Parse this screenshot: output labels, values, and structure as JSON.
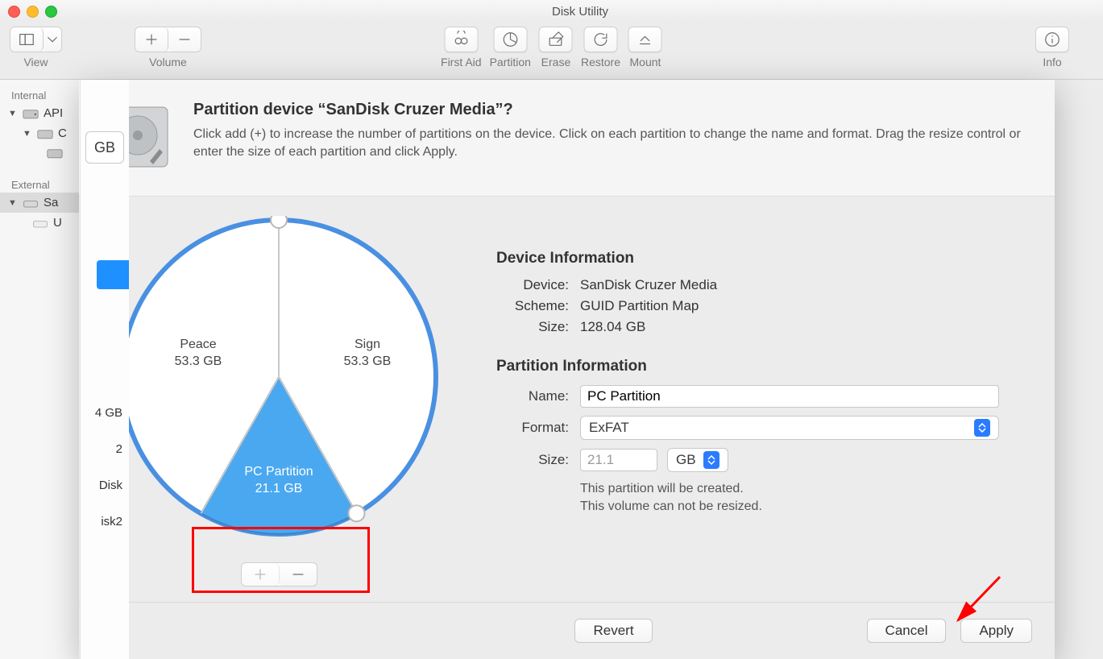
{
  "window_title": "Disk Utility",
  "toolbar": {
    "view_label": "View",
    "volume_label": "Volume",
    "first_aid_label": "First Aid",
    "partition_label": "Partition",
    "erase_label": "Erase",
    "restore_label": "Restore",
    "mount_label": "Mount",
    "info_label": "Info"
  },
  "sidebar": {
    "internal_heading": "Internal",
    "external_heading": "External",
    "internal_items": [
      "API",
      "C",
      ""
    ],
    "external_items": [
      "Sa",
      "U"
    ]
  },
  "rpanel": {
    "gb_btn": "GB",
    "row1": "4 GB",
    "row2": "2",
    "row3": "Disk",
    "row4": "isk2"
  },
  "sheet": {
    "title": "Partition device “SanDisk Cruzer Media”?",
    "desc": "Click add (+) to increase the number of partitions on the device. Click on each partition to change the name and format. Drag the resize control or enter the size of each partition and click Apply.",
    "pie": {
      "p1_name": "Peace",
      "p1_size": "53.3 GB",
      "p2_name": "Sign",
      "p2_size": "53.3 GB",
      "p3_name": "PC Partition",
      "p3_size": "21.1 GB"
    },
    "device_info_heading": "Device Information",
    "device_label": "Device:",
    "device_value": "SanDisk Cruzer Media",
    "scheme_label": "Scheme:",
    "scheme_value": "GUID Partition Map",
    "size_label": "Size:",
    "size_value": "128.04 GB",
    "partition_info_heading": "Partition Information",
    "name_label": "Name:",
    "name_value": "PC Partition",
    "format_label": "Format:",
    "format_value": "ExFAT",
    "psize_label": "Size:",
    "psize_value": "21.1",
    "psize_unit": "GB",
    "note1": "This partition will be created.",
    "note2": "This volume can not be resized.",
    "revert_label": "Revert",
    "cancel_label": "Cancel",
    "apply_label": "Apply"
  },
  "chart_data": {
    "type": "pie",
    "title": "",
    "series": [
      {
        "name": "Peace",
        "value": 53.3,
        "unit": "GB",
        "selected": false
      },
      {
        "name": "Sign",
        "value": 53.3,
        "unit": "GB",
        "selected": false
      },
      {
        "name": "PC Partition",
        "value": 21.1,
        "unit": "GB",
        "selected": true
      }
    ],
    "total": 128.04
  }
}
